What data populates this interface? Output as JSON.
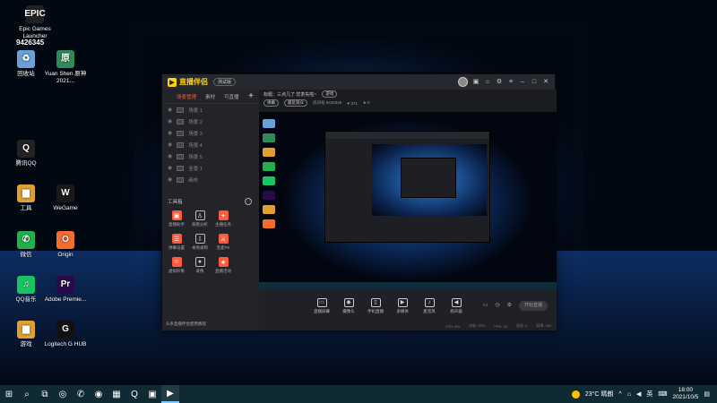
{
  "desktop": {
    "icons": [
      {
        "label": "Epic Games Launcher",
        "icon": "epic-games-icon",
        "color": "#222222",
        "glyph": "EPIC"
      },
      {
        "label": "回收站",
        "icon": "recycle-bin-icon",
        "color": "#6aa0d8",
        "glyph": "♻"
      },
      {
        "label": "Yuan Shen 原神 2021...",
        "icon": "genshin-icon",
        "color": "#2e8b57",
        "glyph": "原"
      },
      {
        "label": "工具",
        "icon": "folder-icon",
        "color": "#e0a030",
        "glyph": "▆"
      },
      {
        "label": "WeGame",
        "icon": "wegame-icon",
        "color": "#1a1a1a",
        "glyph": "W"
      },
      {
        "label": "腾讯QQ",
        "icon": "qq-icon",
        "color": "#222222",
        "glyph": "Q"
      },
      {
        "label": "微信",
        "icon": "wechat-icon",
        "color": "#21b04b",
        "glyph": "✆"
      },
      {
        "label": "Origin",
        "icon": "origin-icon",
        "color": "#f56c2d",
        "glyph": "O"
      },
      {
        "label": "QQ音乐",
        "icon": "qq-music-icon",
        "color": "#18c461",
        "glyph": "♫"
      },
      {
        "label": "Adobe Premie...",
        "icon": "premiere-icon",
        "color": "#2a0a4a",
        "glyph": "Pr"
      },
      {
        "label": "游戏",
        "icon": "games-folder-icon",
        "color": "#e0a030",
        "glyph": "▆"
      },
      {
        "label": "Logitech G HUB",
        "icon": "logitech-icon",
        "color": "#111111",
        "glyph": "G"
      }
    ],
    "overlay_text": "9426345"
  },
  "app": {
    "name": "直播伴侣",
    "version_badge": "测试版",
    "left_tabs": [
      "场景管理",
      "素材",
      "可直播"
    ],
    "scenes": [
      "场景 1",
      "场景 2",
      "场景 3",
      "场景 4",
      "场景 5",
      "全景 1",
      "画布"
    ],
    "toolbox_title": "工具箱",
    "tools": [
      {
        "label": "直播助手",
        "icon": "assistant-icon",
        "style": "red"
      },
      {
        "label": "观看分析",
        "icon": "user-icon",
        "style": "gray"
      },
      {
        "label": "主播任务",
        "icon": "task-icon",
        "style": "red"
      },
      {
        "label": "",
        "icon": "blank-icon",
        "style": "none"
      },
      {
        "label": "弹幕设置",
        "icon": "danmaku-icon",
        "style": "red"
      },
      {
        "label": "本地录制",
        "icon": "download-icon",
        "style": "gray"
      },
      {
        "label": "连麦PK",
        "icon": "pk-icon",
        "style": "red"
      },
      {
        "label": "",
        "icon": "blank-icon",
        "style": "none"
      },
      {
        "label": "虚拟形象",
        "icon": "avatar-icon",
        "style": "red"
      },
      {
        "label": "录像",
        "icon": "record-icon",
        "style": "gray"
      },
      {
        "label": "直播活动",
        "icon": "event-icon",
        "style": "red"
      },
      {
        "label": "",
        "icon": "blank-icon",
        "style": "none"
      }
    ],
    "footer_text": "头条直播伴侣使用教程",
    "room_title": "标题：三点几了 饮茶先啦~",
    "room_tag": "游戏",
    "info_line": [
      "弹幕",
      "最近观众",
      "房间号 9426345",
      "♥ 371",
      "★ 0"
    ],
    "controls": [
      {
        "label": "直播屏幕",
        "icon": "screen-icon",
        "glyph": "▭"
      },
      {
        "label": "摄像头",
        "icon": "camera-icon",
        "glyph": "◉"
      },
      {
        "label": "手机直播",
        "icon": "phone-icon",
        "glyph": "▯"
      },
      {
        "label": "多媒体",
        "icon": "media-icon",
        "glyph": "▶"
      },
      {
        "label": "麦克风",
        "icon": "mic-icon",
        "glyph": "♪"
      },
      {
        "label": "扬声器",
        "icon": "speaker-icon",
        "glyph": "◀"
      }
    ],
    "start_button": "开始直播",
    "status_items": [
      "CPU: 5%",
      "内存: 30%",
      "FPS: 30",
      "丢帧: 0",
      "码率: 0kb"
    ]
  },
  "taskbar": {
    "weather": "23°C 晴朗",
    "ime": "英",
    "time": "18:00",
    "date": "2021/10/5"
  }
}
